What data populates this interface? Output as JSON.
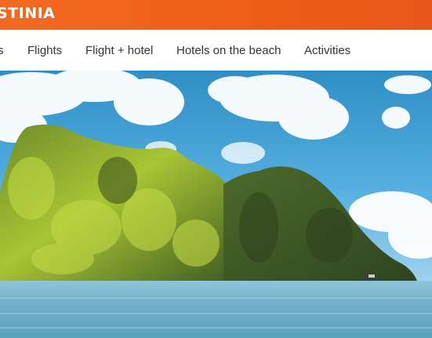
{
  "header": {
    "logo_text": "STINIA",
    "brand_color": "#f0611d"
  },
  "nav": {
    "items": [
      {
        "label": "s"
      },
      {
        "label": "Flights"
      },
      {
        "label": "Flight + hotel"
      },
      {
        "label": "Hotels on the beach"
      },
      {
        "label": "Activities"
      }
    ]
  },
  "hero": {
    "image_description_icon": "island-photo"
  }
}
